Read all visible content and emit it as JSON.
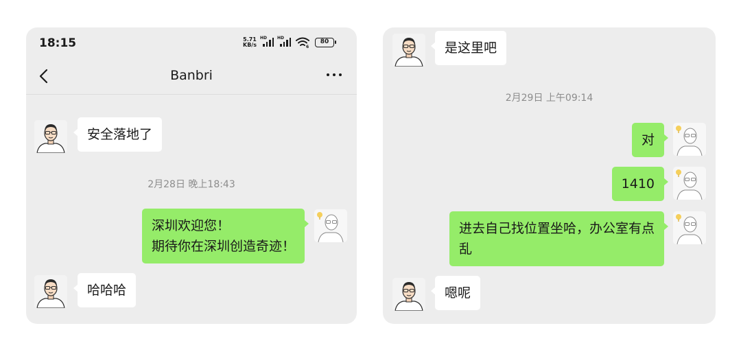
{
  "left_panel": {
    "status_bar": {
      "time": "18:15",
      "speed_value": "5.71",
      "speed_unit": "KB/s",
      "signal1_label": "HD",
      "signal2_label": "HD",
      "wifi_sub": "6",
      "battery": "80"
    },
    "navbar": {
      "back_icon": "chevron-left-icon",
      "title": "Banbri",
      "more_icon": "more-dots-icon"
    },
    "messages": [
      {
        "sender": "contact",
        "lines": [
          "安全落地了"
        ]
      },
      {
        "type": "timestamp",
        "text": "2月28日 晚上18:43"
      },
      {
        "sender": "me",
        "lines": [
          "深圳欢迎您！",
          "期待你在深圳创造奇迹！"
        ]
      },
      {
        "sender": "contact",
        "lines": [
          "哈哈哈"
        ]
      }
    ]
  },
  "right_panel": {
    "messages": [
      {
        "sender": "contact",
        "lines": [
          "是这里吧"
        ]
      },
      {
        "type": "timestamp",
        "text": "2月29日 上午09:14"
      },
      {
        "sender": "me",
        "lines": [
          "对"
        ]
      },
      {
        "sender": "me",
        "lines": [
          "1410"
        ]
      },
      {
        "sender": "me",
        "lines": [
          "进去自己找位置坐哈，办公室有点",
          "乱"
        ]
      },
      {
        "sender": "contact",
        "lines": [
          "嗯呢"
        ]
      }
    ]
  },
  "colors": {
    "chat_background": "#ededed",
    "outgoing_bubble": "#95ec69",
    "incoming_bubble": "#ffffff",
    "timestamp_text": "#8c8c8c"
  }
}
